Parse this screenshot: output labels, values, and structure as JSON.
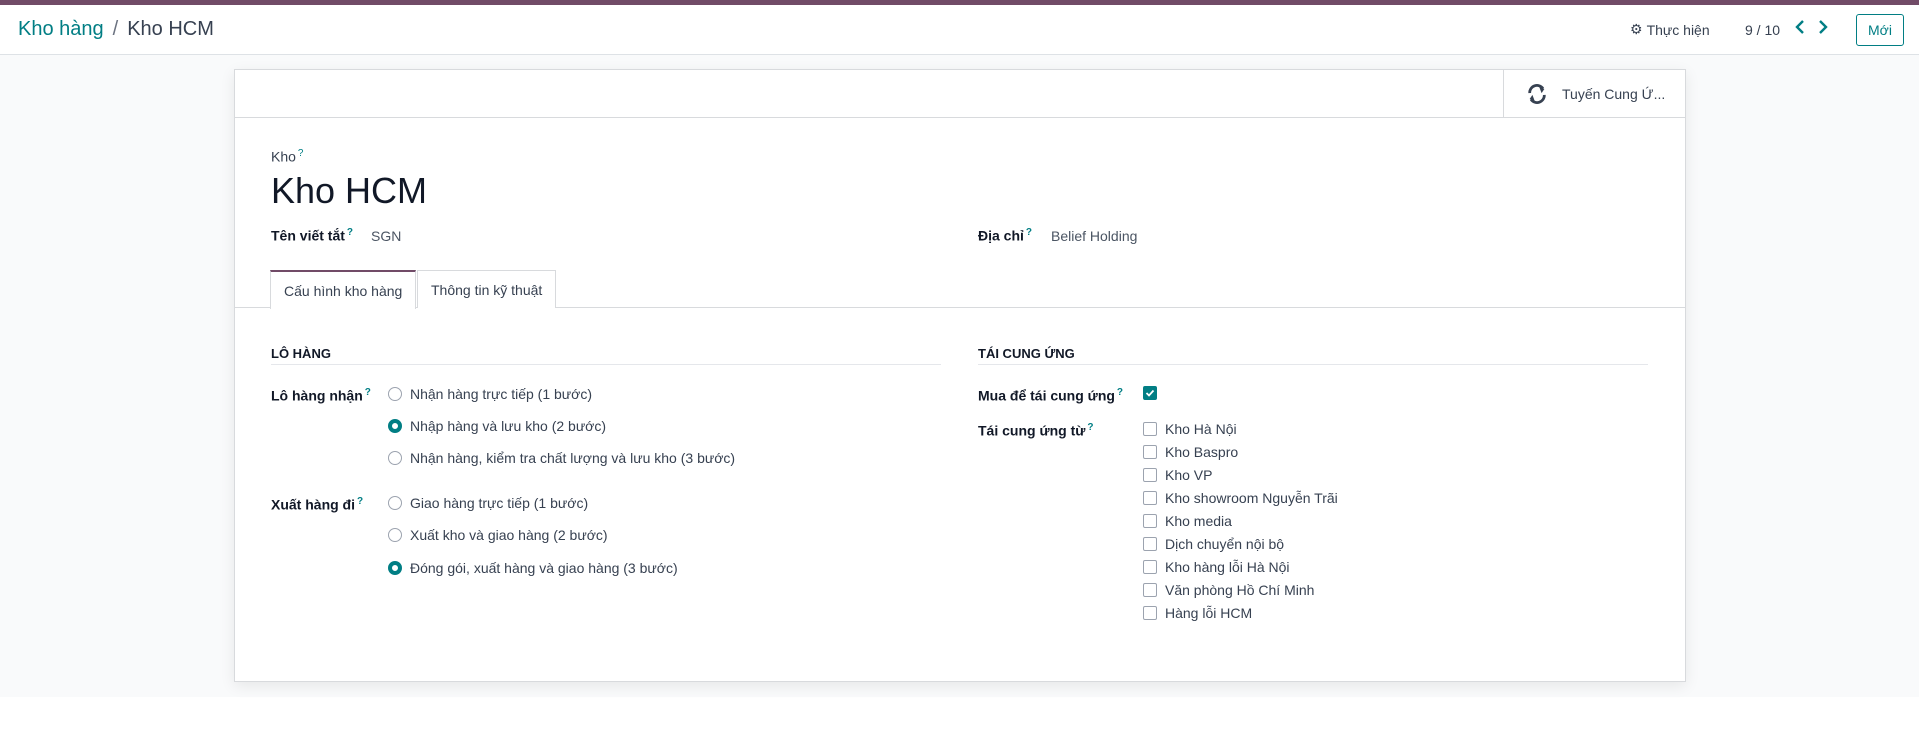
{
  "breadcrumb": {
    "parent": "Kho hàng",
    "separator": "/",
    "current": "Kho HCM"
  },
  "header": {
    "action_label": "Thực hiện",
    "pager": "9 / 10",
    "new_label": "Mới"
  },
  "smart_button": {
    "label": "Tuyến Cung Ứ..."
  },
  "record": {
    "name_label": "Kho",
    "name": "Kho HCM",
    "short_name_label": "Tên viết tắt",
    "short_name": "SGN",
    "address_label": "Địa chỉ",
    "address": "Belief Holding"
  },
  "tabs": [
    {
      "label": "Cấu hình kho hàng"
    },
    {
      "label": "Thông tin kỹ thuật"
    }
  ],
  "shipments": {
    "title": "LÔ HÀNG",
    "incoming_label": "Lô hàng nhận",
    "incoming_options": [
      {
        "label": "Nhận hàng trực tiếp (1 bước)",
        "checked": false
      },
      {
        "label": "Nhập hàng và lưu kho (2 bước)",
        "checked": true
      },
      {
        "label": "Nhận hàng, kiểm tra chất lượng và lưu kho (3 bước)",
        "checked": false
      }
    ],
    "outgoing_label": "Xuất hàng đi",
    "outgoing_options": [
      {
        "label": "Giao hàng trực tiếp (1 bước)",
        "checked": false
      },
      {
        "label": "Xuất kho và giao hàng (2 bước)",
        "checked": false
      },
      {
        "label": "Đóng gói, xuất hàng và giao hàng (3 bước)",
        "checked": true
      }
    ]
  },
  "resupply": {
    "title": "TÁI CUNG ỨNG",
    "buy_label": "Mua để tái cung ứng",
    "buy_checked": true,
    "from_label": "Tái cung ứng từ",
    "warehouses": [
      {
        "label": "Kho Hà Nội",
        "checked": false
      },
      {
        "label": "Kho Baspro",
        "checked": false
      },
      {
        "label": "Kho VP",
        "checked": false
      },
      {
        "label": "Kho showroom Nguyễn Trãi",
        "checked": false
      },
      {
        "label": "Kho media",
        "checked": false
      },
      {
        "label": "Dịch chuyển nội bộ",
        "checked": false
      },
      {
        "label": "Kho hàng lỗi Hà Nội",
        "checked": false
      },
      {
        "label": "Văn phòng Hồ Chí Minh",
        "checked": false
      },
      {
        "label": "Hàng lỗi HCM",
        "checked": false
      }
    ]
  },
  "colors": {
    "accent": "#714B67",
    "primary": "#017e84"
  }
}
